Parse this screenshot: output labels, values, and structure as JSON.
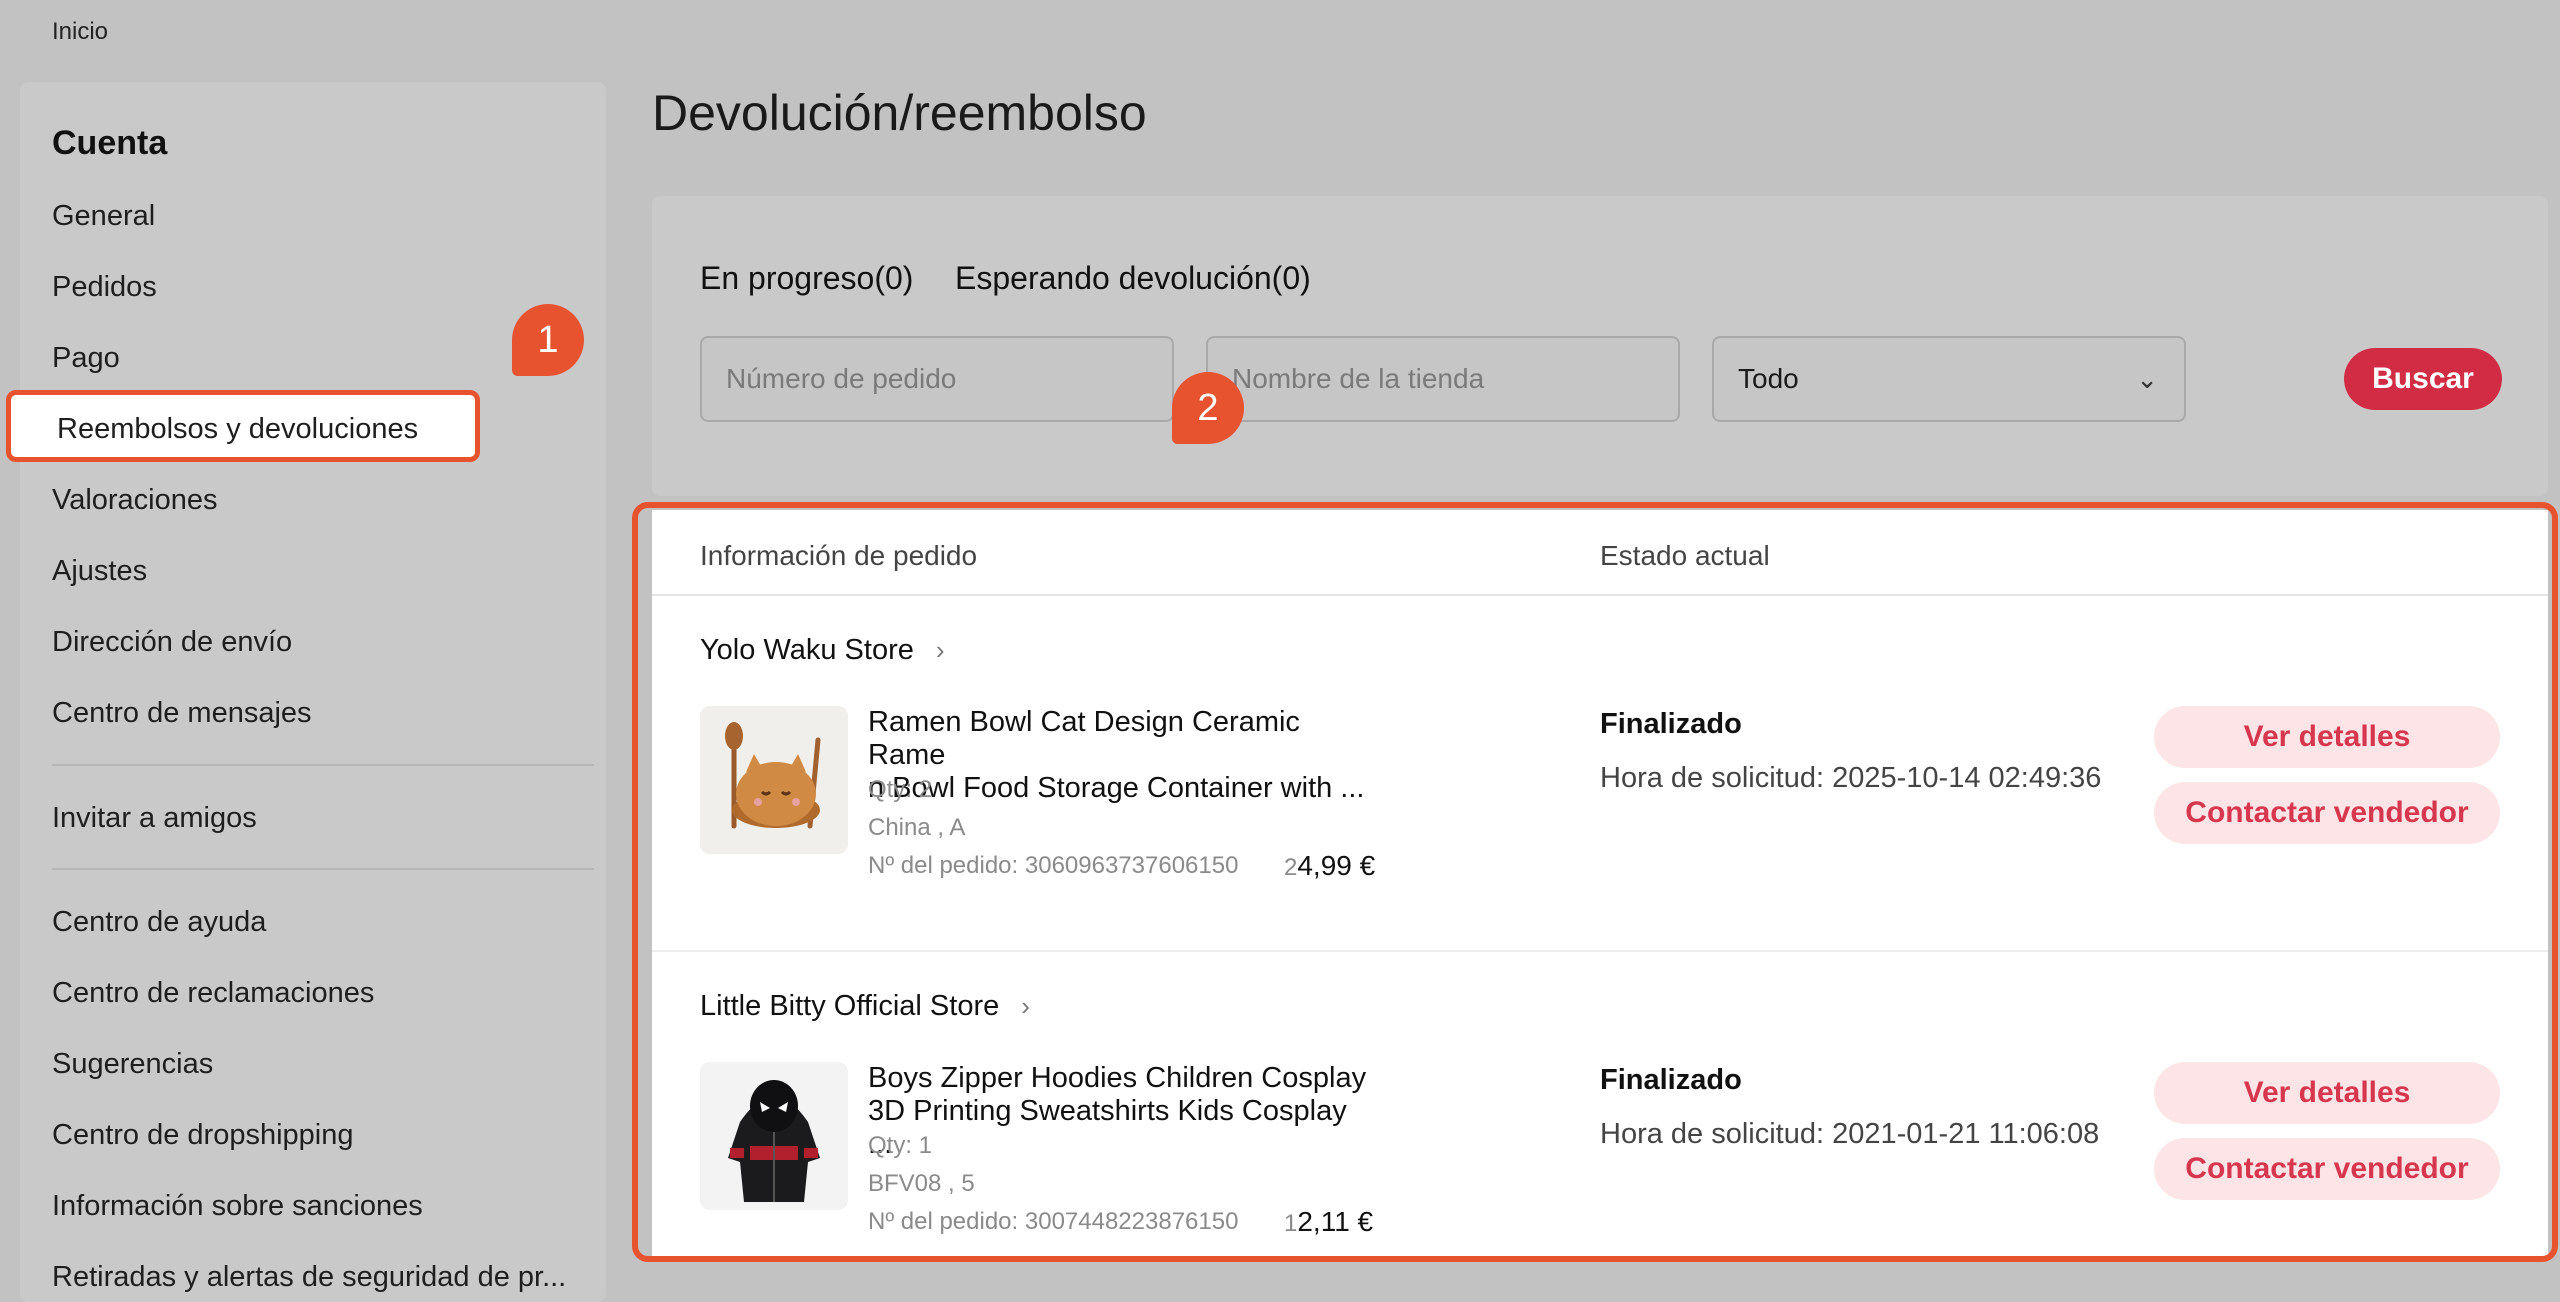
{
  "breadcrumb": "Inicio",
  "sidebar": {
    "heading": "Cuenta",
    "items": [
      "General",
      "Pedidos",
      "Pago",
      "Reembolsos y devoluciones",
      "Valoraciones",
      "Ajustes",
      "Dirección de envío",
      "Centro de mensajes",
      "Invitar a amigos",
      "Centro de ayuda",
      "Centro de reclamaciones",
      "Sugerencias",
      "Centro de dropshipping",
      "Información sobre sanciones",
      "Retiradas y alertas de seguridad de pr..."
    ],
    "active_index": 3
  },
  "badges": [
    "1",
    "2"
  ],
  "page_title": "Devolución/reembolso",
  "tabs": [
    "En progreso(0)",
    "Esperando devolución(0)"
  ],
  "filters": {
    "order_placeholder": "Número de pedido",
    "store_placeholder": "Nombre de la tienda",
    "status_value": "Todo",
    "search_label": "Buscar"
  },
  "table": {
    "col_order_info": "Información de pedido",
    "col_status": "Estado actual"
  },
  "orders": [
    {
      "store": "Yolo Waku Store",
      "product_line1": "Ramen Bowl Cat Design Ceramic Rame",
      "product_line2": "n Bowl Food Storage Container with ...",
      "qty": "Qty: 2",
      "variant": "China , A",
      "order_no": "Nº del pedido: 3060963737606150",
      "price_qty": "2",
      "price": "4,99 €",
      "status": "Finalizado",
      "request_time": "Hora de solicitud: 2025-10-14 02:49:36",
      "details_label": "Ver detalles",
      "contact_label": "Contactar vendedor"
    },
    {
      "store": "Little Bitty Official Store",
      "product_line1": "Boys Zipper Hoodies Children Cosplay",
      "product_line2": "3D Printing Sweatshirts Kids Cosplay ...",
      "qty": "Qty: 1",
      "variant": "BFV08 , 5",
      "order_no": "Nº del pedido: 3007448223876150",
      "price_qty": "1",
      "price": "2,11 €",
      "status": "Finalizado",
      "request_time": "Hora de solicitud: 2021-01-21 11:06:08",
      "details_label": "Ver detalles",
      "contact_label": "Contactar vendedor"
    }
  ],
  "colors": {
    "annotation": "#e8532f",
    "primary": "#d22c45",
    "pill_bg": "#fde4e6",
    "pill_text": "#d6364e"
  }
}
